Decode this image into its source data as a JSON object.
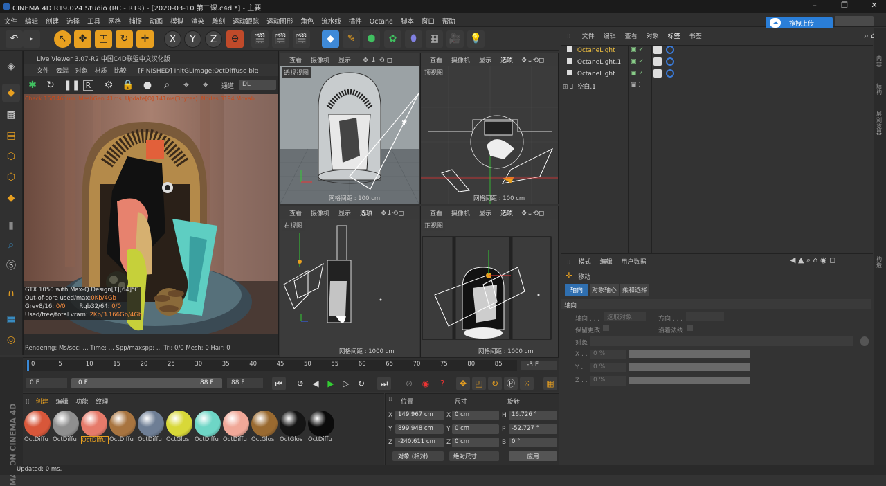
{
  "window": {
    "title": "CINEMA 4D R19.024 Studio (RC - R19) - [2020-03-10 第二课.c4d *] - 主要",
    "min": "–",
    "max": "❐",
    "close": "✕"
  },
  "menu": [
    "文件",
    "编辑",
    "创建",
    "选择",
    "工具",
    "网格",
    "捕捉",
    "动画",
    "模拟",
    "渲染",
    "雕刻",
    "运动跟踪",
    "运动图形",
    "角色",
    "流水线",
    "插件",
    "Octane",
    "脚本",
    "窗口",
    "帮助"
  ],
  "upload": {
    "label": "拖拽上传"
  },
  "toolbar": {
    "undo": "↶",
    "x": "X",
    "y": "Y",
    "z": "Z"
  },
  "liveviewer": {
    "title": "Live Viewer 3.07-R2 中国C4D联盟中文汉化版",
    "menu": [
      "文件",
      "云端",
      "对象",
      "材质",
      "比较"
    ],
    "status": "[FINISHED] InitGLImage:OctDiffuse  bit:",
    "channel_label": "通道:",
    "channel_value": "DL",
    "check": "Check:16/1463ms. MeshGen:41ms. Update[O]:141ms(3bytes). Nodes:3194 Movab",
    "gpu": "GTX 1050 with Max-Q Design[T][64]°C",
    "outofcore_label": "Out-of-core used/max:",
    "outofcore_value": "0Kb/4Gb",
    "grey_label": "Grey8/16: ",
    "grey_value": "0/0",
    "rgb_label": "Rgb32/64: ",
    "rgb_value": "0/0",
    "vram_label": "Used/free/total vram: ",
    "vram_value": "2Kb/3.166Gb/4Gb",
    "bottom": "Rendering:      Ms/sec: ...  Time: ...       Spp/maxspp: ... Tri: 0/0  Mesh: 0     Hair: 0"
  },
  "viewports": {
    "menu_a": [
      "查看",
      "摄像机",
      "显示"
    ],
    "menu_b": [
      "查看",
      "摄像机",
      "显示",
      "选项"
    ],
    "persp": {
      "label": "透视视图",
      "grid": "网格间距 : 100 cm"
    },
    "top": {
      "label": "顶视图",
      "grid": "网格间距 : 100 cm"
    },
    "right": {
      "label": "右视图",
      "grid": "网格间距 : 1000 cm"
    },
    "front": {
      "label": "正视图",
      "grid": "网格间距 : 1000 cm"
    }
  },
  "objects": {
    "tabs": [
      "文件",
      "编辑",
      "查看",
      "对象",
      "标签",
      "书签"
    ],
    "items": [
      {
        "name": "OctaneLight",
        "color": "#f0c040"
      },
      {
        "name": "OctaneLight.1",
        "color": "#d8d8d8"
      },
      {
        "name": "OctaneLight",
        "color": "#d8d8d8"
      },
      {
        "name": "空白.1",
        "color": "#d8d8d8"
      }
    ]
  },
  "attributes": {
    "menu": [
      "模式",
      "编辑",
      "用户数据"
    ],
    "tool": "移动",
    "tabs": [
      "轴向",
      "对象轴心",
      "柔和选择"
    ],
    "section": "轴向",
    "axis_label": "轴向 . . .",
    "axis_value": "选取对象",
    "dir_label": "方向 . . .",
    "dir_value": "",
    "keep_label": "保留更改",
    "normal_label": "沿着法线",
    "object_label": "对象",
    "x_label": "X . .",
    "x_value": "0 %",
    "y_label": "Y . .",
    "y_value": "0 %",
    "z_label": "Z . .",
    "z_value": "0 %"
  },
  "timeline": {
    "ticks": [
      "0",
      "5",
      "10",
      "15",
      "20",
      "25",
      "30",
      "35",
      "40",
      "45",
      "50",
      "55",
      "60",
      "65",
      "70",
      "75",
      "80",
      "85"
    ],
    "end_field": "-3 F",
    "start": "0 F",
    "range_start": "0 F",
    "range_end": "88 F",
    "max": "88 F"
  },
  "materials": {
    "tabs": [
      "创建",
      "编辑",
      "功能",
      "纹理"
    ],
    "items": [
      {
        "name": "OctDiffu",
        "color": "#d8573a"
      },
      {
        "name": "OctDiffu",
        "color": "#8f8f8f"
      },
      {
        "name": "OctDiffu",
        "color": "#e67a6a"
      },
      {
        "name": "OctDiffu",
        "color": "#a8743f"
      },
      {
        "name": "OctDiffu",
        "color": "#6e7e95"
      },
      {
        "name": "OctGlos",
        "color": "#d8d838"
      },
      {
        "name": "OctDiffu",
        "color": "#6ed6c6"
      },
      {
        "name": "OctDiffu",
        "color": "#f0a898"
      },
      {
        "name": "OctGlos",
        "color": "#9a6a30"
      },
      {
        "name": "OctGlos",
        "color": "#151515"
      },
      {
        "name": "OctDiffu",
        "color": "#0b0b0b"
      }
    ],
    "selected_index": 2
  },
  "coords": {
    "headers": [
      "位置",
      "尺寸",
      "旋转"
    ],
    "x_pos": "149.967 cm",
    "y_pos": "899.948 cm",
    "z_pos": "-240.611 cm",
    "x_size": "0 cm",
    "y_size": "0 cm",
    "z_size": "0 cm",
    "h": "16.726 °",
    "p": "-52.727 °",
    "b": "0 °",
    "mode": "对象 (相对)",
    "size_mode": "绝对尺寸",
    "apply": "应用"
  },
  "logo": "MAXON CINEMA 4D",
  "status": "Updated: 0 ms.",
  "side_tabs": [
    "内容",
    "结构",
    "层浏览器",
    "构造"
  ]
}
